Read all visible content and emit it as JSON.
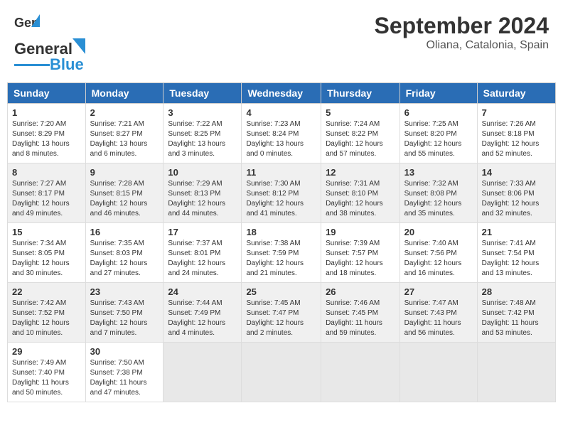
{
  "header": {
    "logo_general": "General",
    "logo_blue": "Blue",
    "title": "September 2024",
    "subtitle": "Oliana, Catalonia, Spain"
  },
  "calendar": {
    "headers": [
      "Sunday",
      "Monday",
      "Tuesday",
      "Wednesday",
      "Thursday",
      "Friday",
      "Saturday"
    ],
    "weeks": [
      [
        {
          "day": "",
          "empty": true
        },
        {
          "day": "",
          "empty": true
        },
        {
          "day": "",
          "empty": true
        },
        {
          "day": "",
          "empty": true
        },
        {
          "day": "",
          "empty": true
        },
        {
          "day": "",
          "empty": true
        },
        {
          "day": "",
          "empty": true
        }
      ],
      [
        {
          "day": "1",
          "sunrise": "7:20 AM",
          "sunset": "8:29 PM",
          "daylight": "13 hours and 8 minutes."
        },
        {
          "day": "2",
          "sunrise": "7:21 AM",
          "sunset": "8:27 PM",
          "daylight": "13 hours and 6 minutes."
        },
        {
          "day": "3",
          "sunrise": "7:22 AM",
          "sunset": "8:25 PM",
          "daylight": "13 hours and 3 minutes."
        },
        {
          "day": "4",
          "sunrise": "7:23 AM",
          "sunset": "8:24 PM",
          "daylight": "13 hours and 0 minutes."
        },
        {
          "day": "5",
          "sunrise": "7:24 AM",
          "sunset": "8:22 PM",
          "daylight": "12 hours and 57 minutes."
        },
        {
          "day": "6",
          "sunrise": "7:25 AM",
          "sunset": "8:20 PM",
          "daylight": "12 hours and 55 minutes."
        },
        {
          "day": "7",
          "sunrise": "7:26 AM",
          "sunset": "8:18 PM",
          "daylight": "12 hours and 52 minutes."
        }
      ],
      [
        {
          "day": "8",
          "sunrise": "7:27 AM",
          "sunset": "8:17 PM",
          "daylight": "12 hours and 49 minutes."
        },
        {
          "day": "9",
          "sunrise": "7:28 AM",
          "sunset": "8:15 PM",
          "daylight": "12 hours and 46 minutes."
        },
        {
          "day": "10",
          "sunrise": "7:29 AM",
          "sunset": "8:13 PM",
          "daylight": "12 hours and 44 minutes."
        },
        {
          "day": "11",
          "sunrise": "7:30 AM",
          "sunset": "8:12 PM",
          "daylight": "12 hours and 41 minutes."
        },
        {
          "day": "12",
          "sunrise": "7:31 AM",
          "sunset": "8:10 PM",
          "daylight": "12 hours and 38 minutes."
        },
        {
          "day": "13",
          "sunrise": "7:32 AM",
          "sunset": "8:08 PM",
          "daylight": "12 hours and 35 minutes."
        },
        {
          "day": "14",
          "sunrise": "7:33 AM",
          "sunset": "8:06 PM",
          "daylight": "12 hours and 32 minutes."
        }
      ],
      [
        {
          "day": "15",
          "sunrise": "7:34 AM",
          "sunset": "8:05 PM",
          "daylight": "12 hours and 30 minutes."
        },
        {
          "day": "16",
          "sunrise": "7:35 AM",
          "sunset": "8:03 PM",
          "daylight": "12 hours and 27 minutes."
        },
        {
          "day": "17",
          "sunrise": "7:37 AM",
          "sunset": "8:01 PM",
          "daylight": "12 hours and 24 minutes."
        },
        {
          "day": "18",
          "sunrise": "7:38 AM",
          "sunset": "7:59 PM",
          "daylight": "12 hours and 21 minutes."
        },
        {
          "day": "19",
          "sunrise": "7:39 AM",
          "sunset": "7:57 PM",
          "daylight": "12 hours and 18 minutes."
        },
        {
          "day": "20",
          "sunrise": "7:40 AM",
          "sunset": "7:56 PM",
          "daylight": "12 hours and 16 minutes."
        },
        {
          "day": "21",
          "sunrise": "7:41 AM",
          "sunset": "7:54 PM",
          "daylight": "12 hours and 13 minutes."
        }
      ],
      [
        {
          "day": "22",
          "sunrise": "7:42 AM",
          "sunset": "7:52 PM",
          "daylight": "12 hours and 10 minutes."
        },
        {
          "day": "23",
          "sunrise": "7:43 AM",
          "sunset": "7:50 PM",
          "daylight": "12 hours and 7 minutes."
        },
        {
          "day": "24",
          "sunrise": "7:44 AM",
          "sunset": "7:49 PM",
          "daylight": "12 hours and 4 minutes."
        },
        {
          "day": "25",
          "sunrise": "7:45 AM",
          "sunset": "7:47 PM",
          "daylight": "12 hours and 2 minutes."
        },
        {
          "day": "26",
          "sunrise": "7:46 AM",
          "sunset": "7:45 PM",
          "daylight": "11 hours and 59 minutes."
        },
        {
          "day": "27",
          "sunrise": "7:47 AM",
          "sunset": "7:43 PM",
          "daylight": "11 hours and 56 minutes."
        },
        {
          "day": "28",
          "sunrise": "7:48 AM",
          "sunset": "7:42 PM",
          "daylight": "11 hours and 53 minutes."
        }
      ],
      [
        {
          "day": "29",
          "sunrise": "7:49 AM",
          "sunset": "7:40 PM",
          "daylight": "11 hours and 50 minutes."
        },
        {
          "day": "30",
          "sunrise": "7:50 AM",
          "sunset": "7:38 PM",
          "daylight": "11 hours and 47 minutes."
        },
        {
          "day": "",
          "empty": true
        },
        {
          "day": "",
          "empty": true
        },
        {
          "day": "",
          "empty": true
        },
        {
          "day": "",
          "empty": true
        },
        {
          "day": "",
          "empty": true
        }
      ]
    ]
  }
}
